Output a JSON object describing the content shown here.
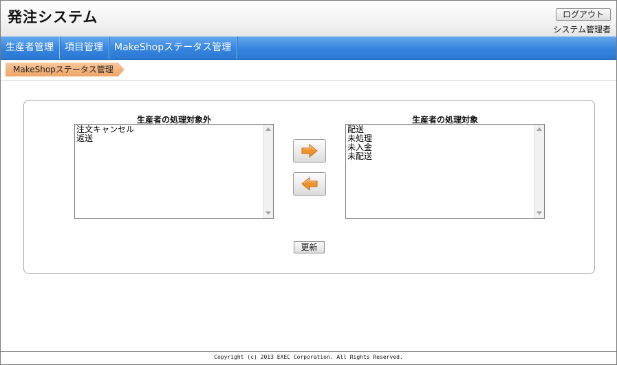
{
  "header": {
    "app_title": "発注システム",
    "logout_label": "ログアウト",
    "user_role": "システム管理者"
  },
  "nav": {
    "items": [
      {
        "label": "生産者管理"
      },
      {
        "label": "項目管理"
      },
      {
        "label": "MakeShopステータス管理"
      }
    ]
  },
  "breadcrumb": {
    "current": "MakeShopステータス管理"
  },
  "lists": {
    "excluded": {
      "title": "生産者の処理対象外",
      "options": [
        "注文キャンセル",
        "返送"
      ]
    },
    "included": {
      "title": "生産者の処理対象",
      "options": [
        "配送",
        "未処理",
        "未入金",
        "未配送"
      ]
    }
  },
  "buttons": {
    "move_right_icon": "arrow-right-icon",
    "move_left_icon": "arrow-left-icon",
    "update_label": "更新"
  },
  "footer": {
    "copyright": "Copyright (c) 2013 EXEC Corporation. All Rights Reserved."
  },
  "colors": {
    "nav_blue": "#3484df",
    "breadcrumb_orange": "#f0a565",
    "arrow_orange": "#f0922a"
  }
}
